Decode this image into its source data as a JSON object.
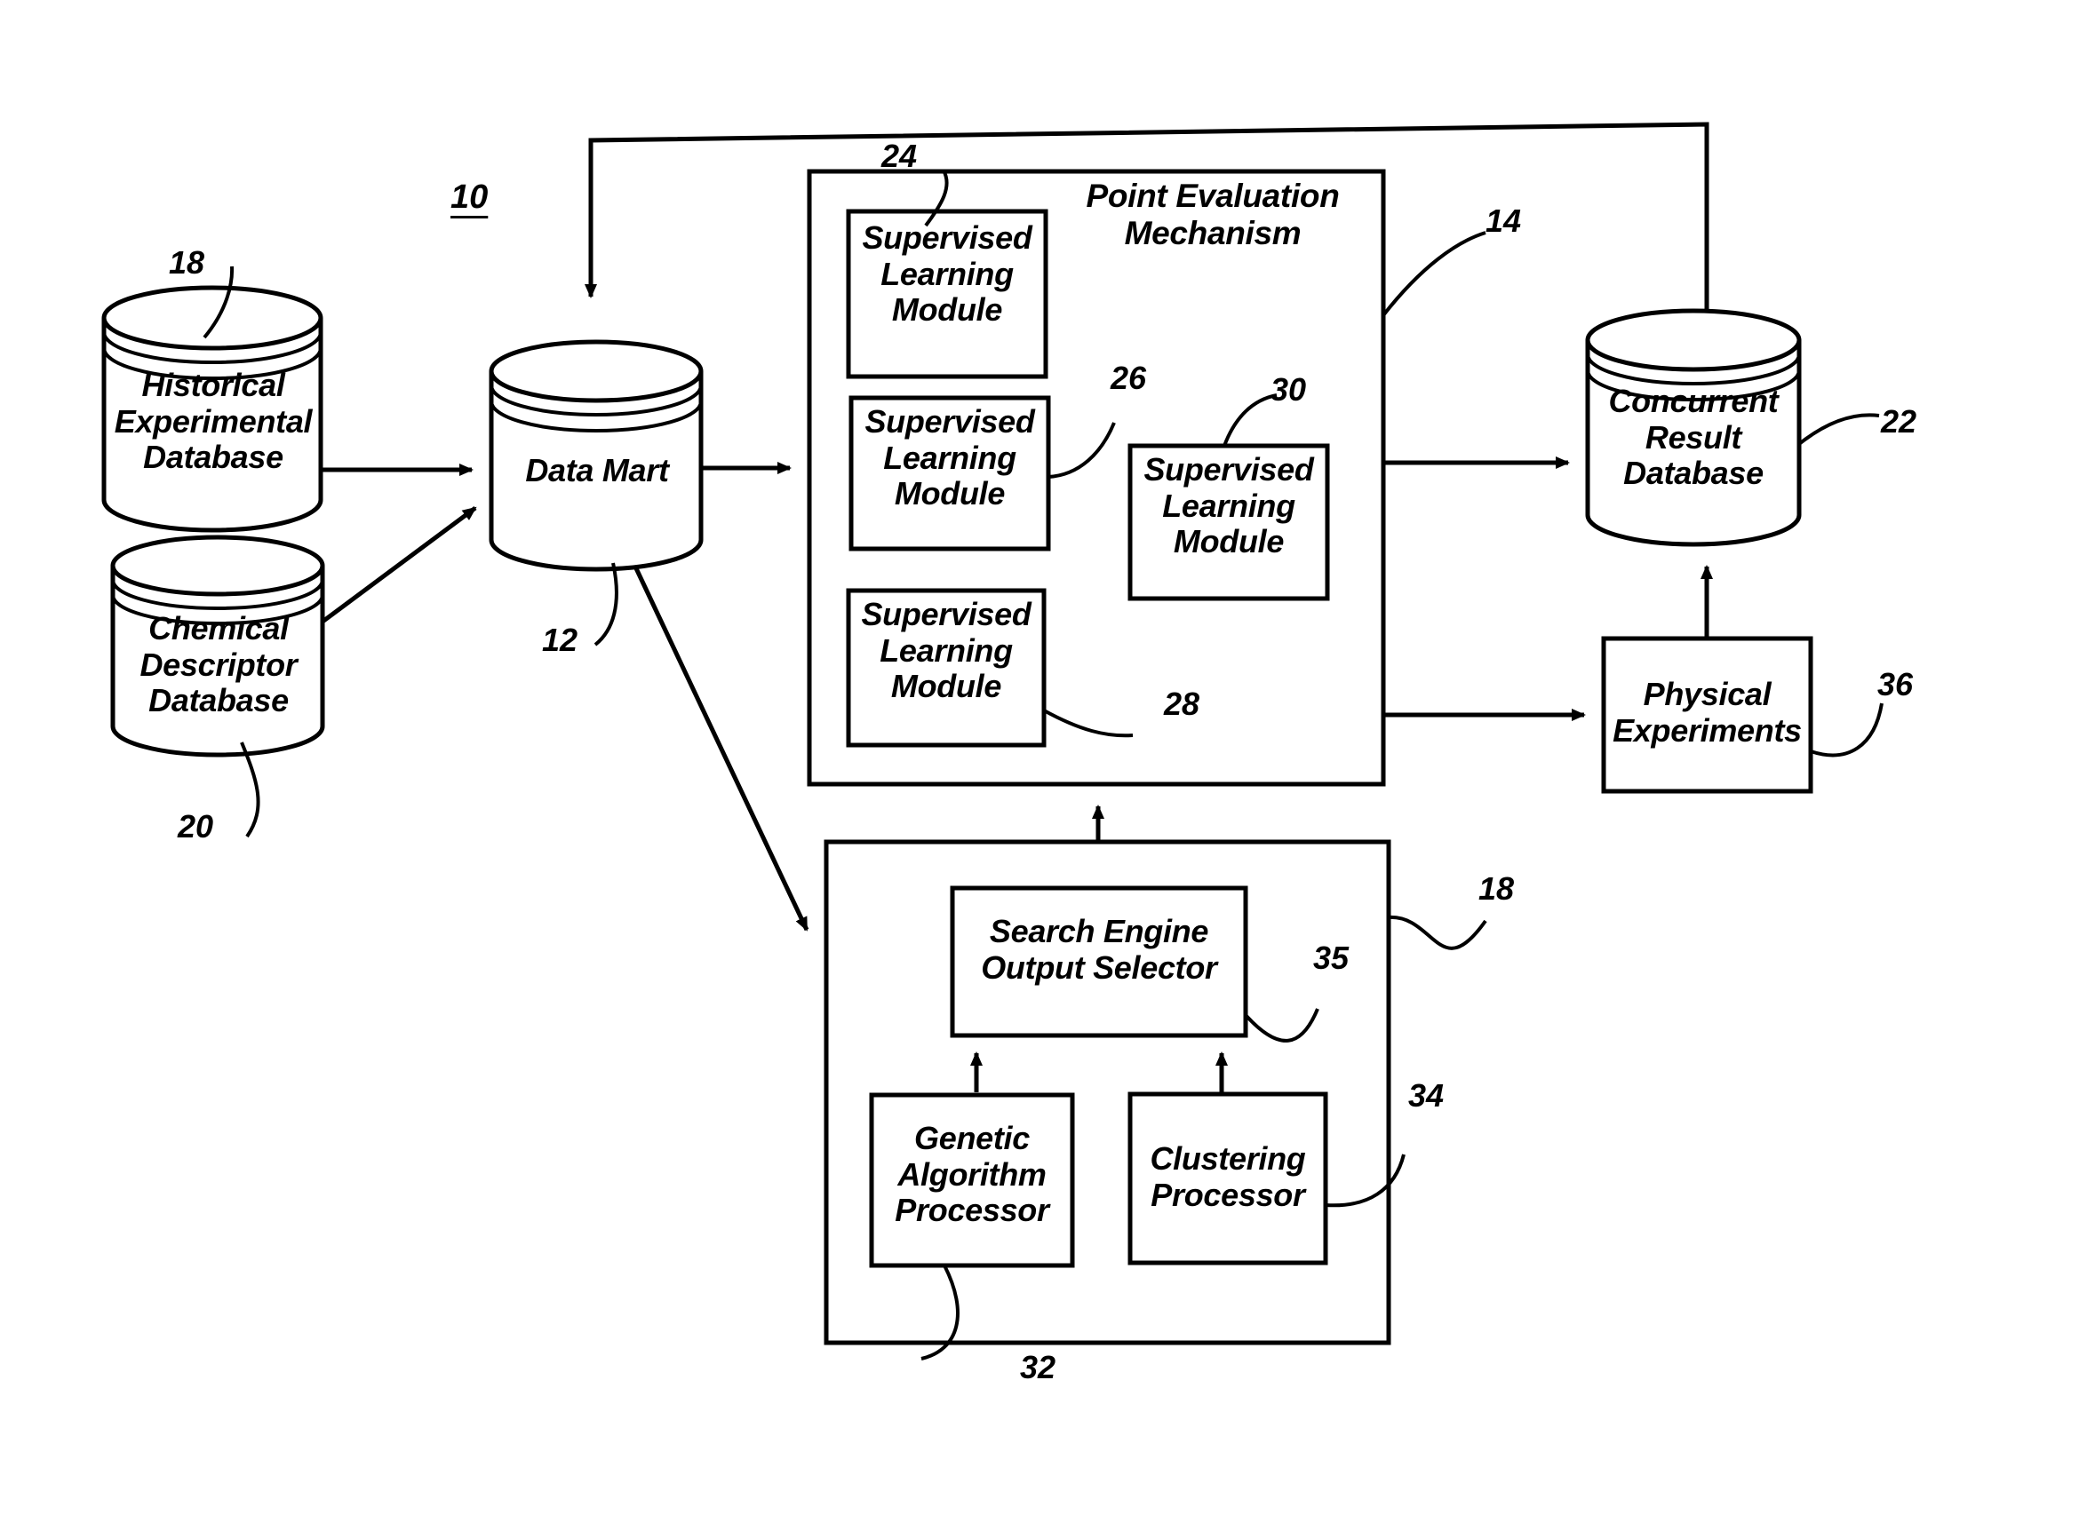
{
  "figure": {
    "system_ref": "10",
    "nodes": {
      "historical_db": {
        "label": "Historical\nExperimental\nDatabase",
        "ref": "18",
        "shape": "cylinder"
      },
      "chemical_db": {
        "label": "Chemical\nDescriptor\nDatabase",
        "ref": "20",
        "shape": "cylinder"
      },
      "data_mart": {
        "label": "Data Mart",
        "ref": "12",
        "shape": "cylinder"
      },
      "point_evaluation": {
        "label": "Point Evaluation\nMechanism",
        "ref": "14",
        "shape": "box"
      },
      "slm_24": {
        "label": "Supervised\nLearning\nModule",
        "ref": "24",
        "shape": "box"
      },
      "slm_26": {
        "label": "Supervised\nLearning\nModule",
        "ref": "26",
        "shape": "box"
      },
      "slm_28": {
        "label": "Supervised\nLearning\nModule",
        "ref": "28",
        "shape": "box"
      },
      "slm_30": {
        "label": "Supervised\nLearning\nModule",
        "ref": "30",
        "shape": "box"
      },
      "concurrent_db": {
        "label": "Concurrent\nResult\nDatabase",
        "ref": "22",
        "shape": "cylinder"
      },
      "physical_experiments": {
        "label": "Physical\nExperiments",
        "ref": "36",
        "shape": "box"
      },
      "search_engine": {
        "label": "Search Engine\nOutput Selector",
        "ref": "35",
        "shape": "box"
      },
      "search_engine_container": {
        "ref": "18",
        "shape": "box"
      },
      "genetic_algorithm": {
        "label": "Genetic\nAlgorithm\nProcessor",
        "ref": "32",
        "shape": "box"
      },
      "clustering": {
        "label": "Clustering\nProcessor",
        "ref": "34",
        "shape": "box"
      }
    },
    "refs": {
      "r10": "10",
      "r12": "12",
      "r14": "14",
      "r18_top": "18",
      "r18_bottom": "18",
      "r20": "20",
      "r22": "22",
      "r24": "24",
      "r26": "26",
      "r28": "28",
      "r30": "30",
      "r32": "32",
      "r34": "34",
      "r35": "35",
      "r36": "36"
    },
    "colors": {
      "stroke": "#000000",
      "fill": "#ffffff",
      "background": "#ffffff"
    }
  }
}
